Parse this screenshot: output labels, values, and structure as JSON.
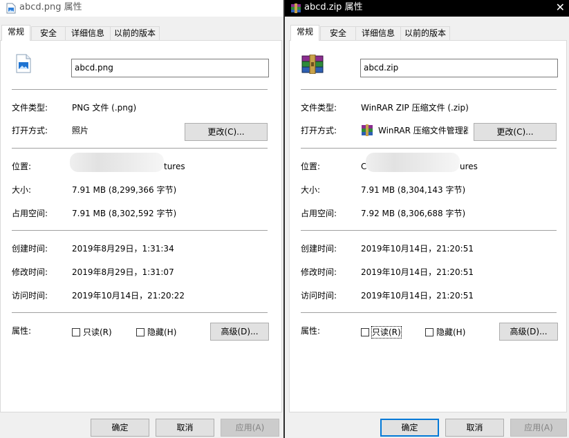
{
  "left": {
    "title": "abcd.png 属性",
    "tabs": [
      "常规",
      "安全",
      "详细信息",
      "以前的版本"
    ],
    "filename": "abcd.png",
    "rows": {
      "type_label": "文件类型:",
      "type_value": "PNG 文件 (.png)",
      "open_label": "打开方式:",
      "open_value": "照片",
      "change_button": "更改(C)...",
      "location_label": "位置:",
      "location_value": "tures",
      "size_label": "大小:",
      "size_value": "7.91 MB (8,299,366 字节)",
      "disk_label": "占用空间:",
      "disk_value": "7.91 MB (8,302,592 字节)",
      "created_label": "创建时间:",
      "created_value": "2019年8月29日，1:31:34",
      "modified_label": "修改时间:",
      "modified_value": "2019年8月29日，1:31:07",
      "accessed_label": "访问时间:",
      "accessed_value": "2019年10月14日，21:20:22",
      "attr_label": "属性:",
      "readonly": "只读(R)",
      "hidden": "隐藏(H)",
      "advanced_button": "高级(D)..."
    },
    "buttons": {
      "ok": "确定",
      "cancel": "取消",
      "apply": "应用(A)"
    }
  },
  "right": {
    "title": "abcd.zip 属性",
    "tabs": [
      "常规",
      "安全",
      "详细信息",
      "以前的版本"
    ],
    "filename": "abcd.zip",
    "rows": {
      "type_label": "文件类型:",
      "type_value": "WinRAR ZIP 压缩文件 (.zip)",
      "open_label": "打开方式:",
      "open_value": "WinRAR 压缩文件管理器",
      "change_button": "更改(C)...",
      "location_label": "位置:",
      "location_prefix": "C",
      "location_value": "ures",
      "size_label": "大小:",
      "size_value": "7.91 MB (8,304,143 字节)",
      "disk_label": "占用空间:",
      "disk_value": "7.92 MB (8,306,688 字节)",
      "created_label": "创建时间:",
      "created_value": "2019年10月14日，21:20:51",
      "modified_label": "修改时间:",
      "modified_value": "2019年10月14日，21:20:51",
      "accessed_label": "访问时间:",
      "accessed_value": "2019年10月14日，21:20:51",
      "attr_label": "属性:",
      "readonly": "只读(R)",
      "hidden": "隐藏(H)",
      "advanced_button": "高级(D)..."
    },
    "buttons": {
      "ok": "确定",
      "cancel": "取消",
      "apply": "应用(A)"
    }
  },
  "colors": {
    "default_button_border": "#0078d7",
    "right_titlebar": "#000000"
  },
  "icons": {
    "png_file": "image-file-icon",
    "zip_file": "winrar-archive-icon",
    "close": "close-icon"
  }
}
